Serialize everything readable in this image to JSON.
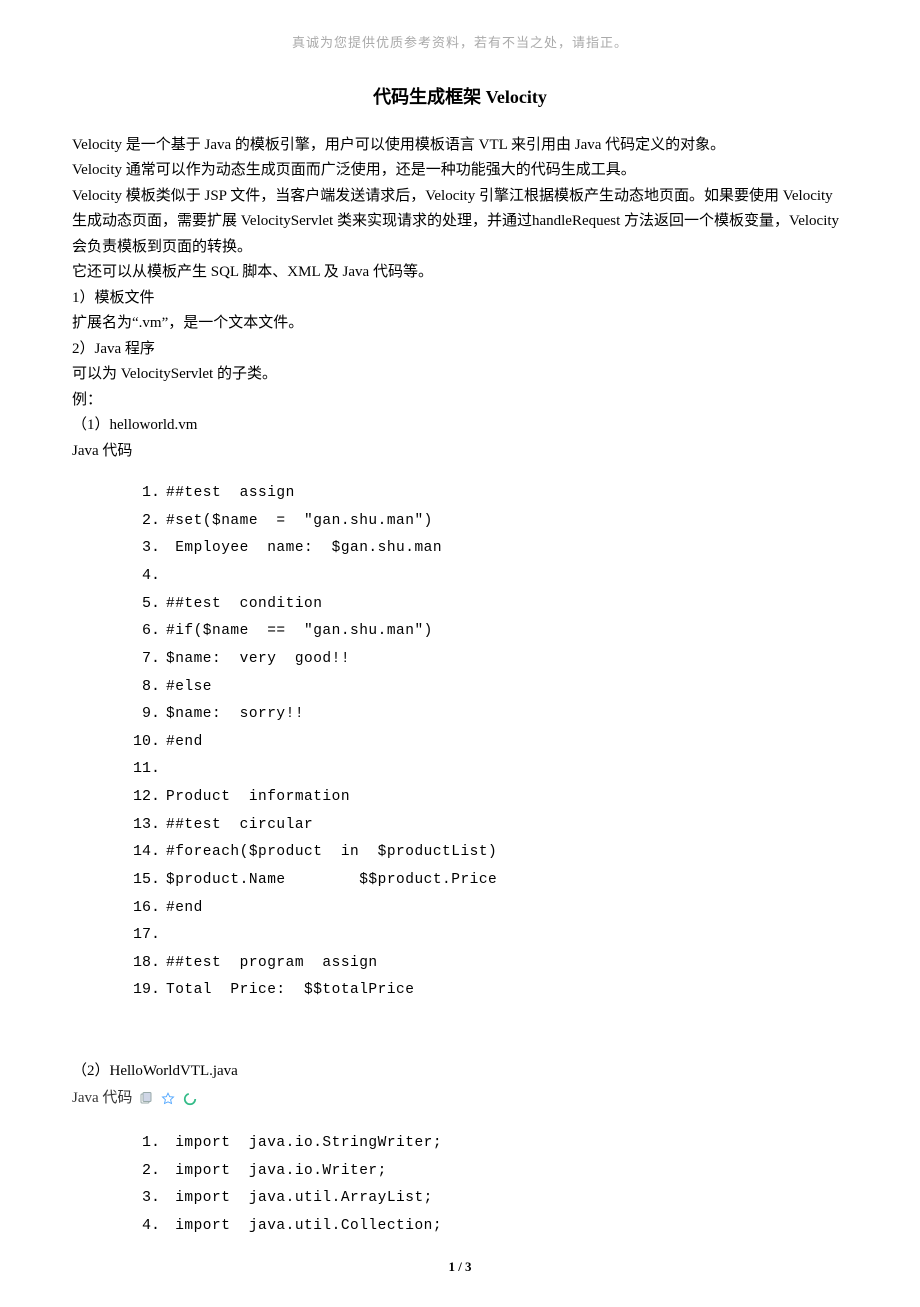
{
  "header_note": "真诚为您提供优质参考资料，若有不当之处，请指正。",
  "title": "代码生成框架 Velocity",
  "paragraphs": [
    "Velocity 是一个基于 Java 的模板引擎，用户可以使用模板语言 VTL 来引用由 Java 代码定义的对象。",
    "Velocity 通常可以作为动态生成页面而广泛使用，还是一种功能强大的代码生成工具。",
    "Velocity 模板类似于 JSP 文件，当客户端发送请求后，Velocity 引擎江根据模板产生动态地页面。如果要使用 Velocity 生成动态页面，需要扩展 VelocityServlet 类来实现请求的处理，并通过handleRequest 方法返回一个模板变量，Velocity 会负责模板到页面的转换。",
    "它还可以从模板产生 SQL 脚本、XML 及 Java 代码等。",
    "1）模板文件",
    "扩展名为“.vm”，是一个文本文件。",
    "2）Java 程序",
    "可以为 VelocityServlet 的子类。",
    "例：",
    "（1）helloworld.vm",
    "Java 代码"
  ],
  "code1": [
    "##test  assign",
    "#set($name  =  \"gan.shu.man\")",
    " Employee  name:  $gan.shu.man",
    "",
    "##test  condition",
    "#if($name  ==  \"gan.shu.man\")",
    "$name:  very  good!!",
    "#else",
    "$name:  sorry!!",
    "#end",
    "",
    "Product  information",
    "##test  circular",
    "#foreach($product  in  $productList)",
    "$product.Name        $$product.Price",
    "#end",
    "",
    "##test  program  assign",
    "Total  Price:  $$totalPrice"
  ],
  "section2_lines": [
    "（2）HelloWorldVTL.java"
  ],
  "java_label": "Java 代码",
  "icons": {
    "copy": "copy-icon",
    "star": "star-icon",
    "loading": "loading-icon"
  },
  "code2": [
    " import  java.io.StringWriter;",
    " import  java.io.Writer;",
    " import  java.util.ArrayList;",
    " import  java.util.Collection;"
  ],
  "footer": "1 / 3"
}
